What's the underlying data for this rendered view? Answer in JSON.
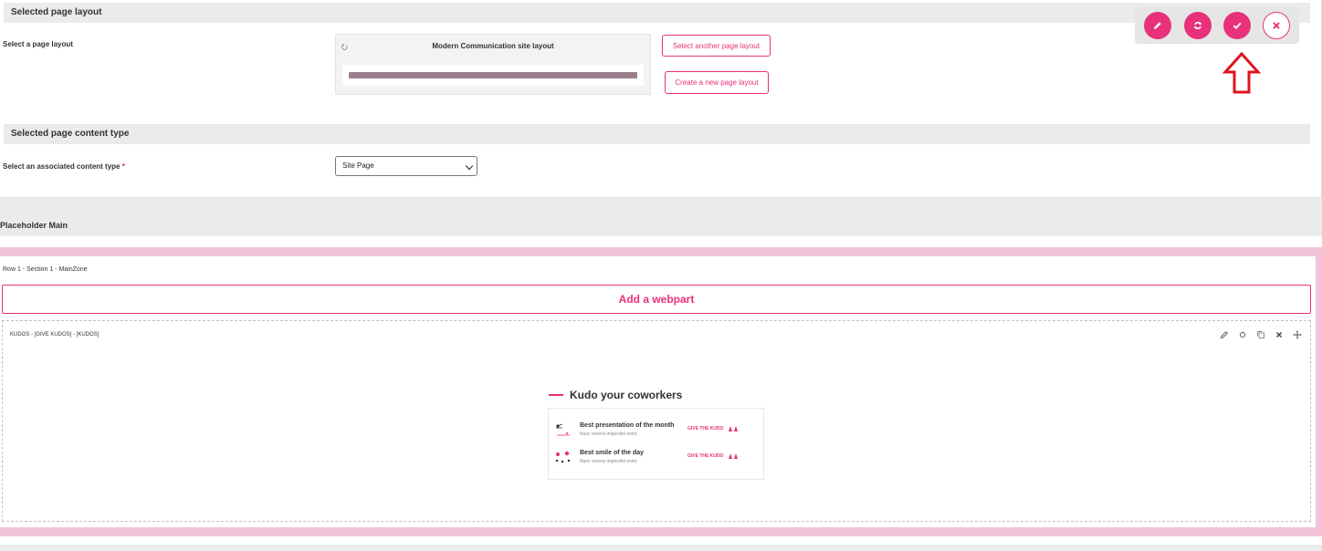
{
  "layout_section": {
    "header": "Selected page layout",
    "field_label": "Select a page layout",
    "card_title": "Modern Communication site layout",
    "select_another_label": "Select another page layout",
    "create_new_label": "Create a new page layout"
  },
  "content_type_section": {
    "header": "Selected page content type",
    "field_label": "Select an associated content type",
    "required_mark": "*",
    "selected_value": "Site Page"
  },
  "toolbar": {
    "edit_icon": "pencil-icon",
    "refresh_icon": "refresh-icon",
    "save_icon": "check-icon",
    "close_icon": "close-icon"
  },
  "placeholder": {
    "label": "Placeholder Main"
  },
  "zone": {
    "label": "Row 1 - Section 1 - MainZone",
    "add_webpart_label": "Add a webpart"
  },
  "webpart": {
    "label": "KUDOS - [GIVE KUDOS] - [KUDOS]",
    "kudo_title": "Kudo your coworkers",
    "items": [
      {
        "title": "Best presentation of the month",
        "subtitle": "Nunc viverra imperdiet enim.",
        "action": "GIVE THE KUDO"
      },
      {
        "title": "Best smile of the day",
        "subtitle": "Nunc viverra imperdiet enim.",
        "action": "GIVE THE KUDO"
      }
    ]
  },
  "colors": {
    "accent": "#e8317a",
    "zone_border": "#f2c4da",
    "annotation_arrow": "#e0141e"
  }
}
